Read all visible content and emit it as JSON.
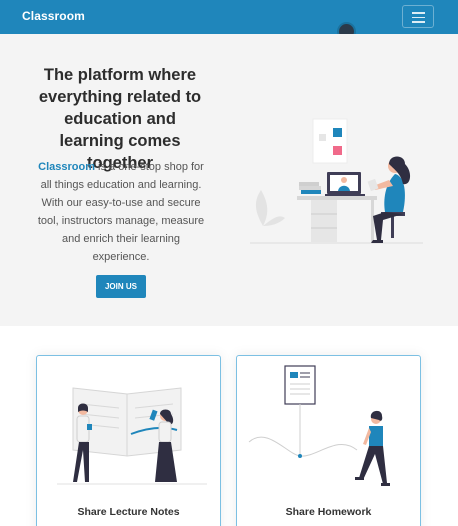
{
  "navbar": {
    "brand": "Classroom",
    "menu_icon": "hamburger-icon"
  },
  "hero": {
    "title": "The platform where everything related to education and learning comes together",
    "brand_highlight": "Classroom",
    "description": " is a one-stop shop for all things education and learning. With our easy-to-use and secure tool, instructors manage, measure and enrich their learning experience.",
    "cta_label": "JOIN US"
  },
  "features": [
    {
      "title": "Share Lecture Notes"
    },
    {
      "title": "Share Homework"
    }
  ],
  "colors": {
    "primary": "#1f86bb",
    "accent_pink": "#f06a8a",
    "hero_bg": "#f4f4f4"
  }
}
